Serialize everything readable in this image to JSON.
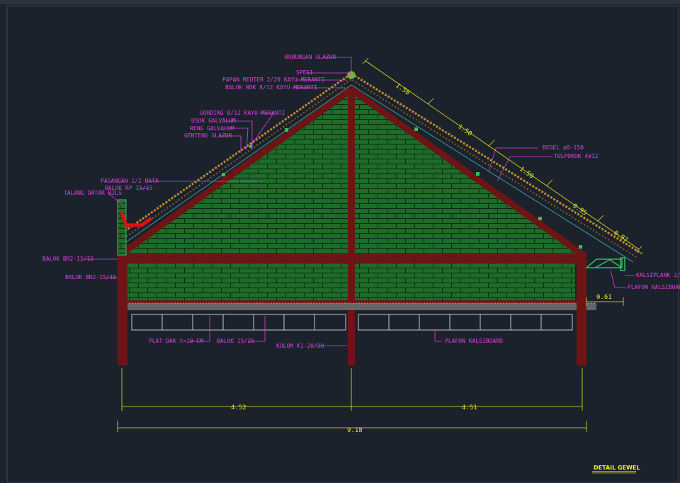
{
  "drawing": {
    "title": "DETAIL GEWEL",
    "labels": {
      "bubungan": "BUBUNGAN GLAZUR",
      "spesi": "SPESI",
      "papan_reuter": "PAPAN REUTER 2/20 KAYU MERANTI",
      "balok_nok": "BALOK NOK 8/12 KAYU MERANTI",
      "gording": "GORDING 8/12 KAYU MERANTI",
      "usuk": "USUK GALVALUM",
      "reng": "RENG GALVALUM",
      "genteng": "GENTENG GLAZUR",
      "pasangan": "PASANGAN 1/2 BATA",
      "balok_rp": "BALOK RP 15/15",
      "talang": "TALANG DATAR BJLS",
      "balok_br2_a": "BALOK BR2-15/15",
      "balok_br2_b": "BALOK BR2-15/15",
      "begel": "BEGEL ø8-150",
      "tulpokok": "TULPOKOK 4ø12",
      "kalsiplank": "KALSIPLANK 2/20",
      "plafon_right": "PLAFON KALSIBOARD",
      "plat_dak": "PLAT DAK t=10 CM",
      "balok_15_25": "BALOK 15/25",
      "kolom": "KOLOM K1-20/20",
      "plafon_bottom": "PLAFON KALSIBOARD"
    },
    "dimensions": {
      "slope_1": "1.58",
      "slope_2": "1.50",
      "slope_3": "1.50",
      "slope_4": "0.95",
      "slope_5": "0.97",
      "overhang": "0.61",
      "left_span": "4.52",
      "right_span": "4.51",
      "total": "9.18"
    }
  },
  "colors": {
    "background": "#1b222c",
    "brick": "#1e6b2a",
    "mortar": "#0a2a10",
    "structure": "#6e1414",
    "roof_tile": "#c08a30",
    "label": "#e040e0",
    "dimension": "#e8e820",
    "leader": "#e040e0",
    "gutter": "#e01010"
  }
}
